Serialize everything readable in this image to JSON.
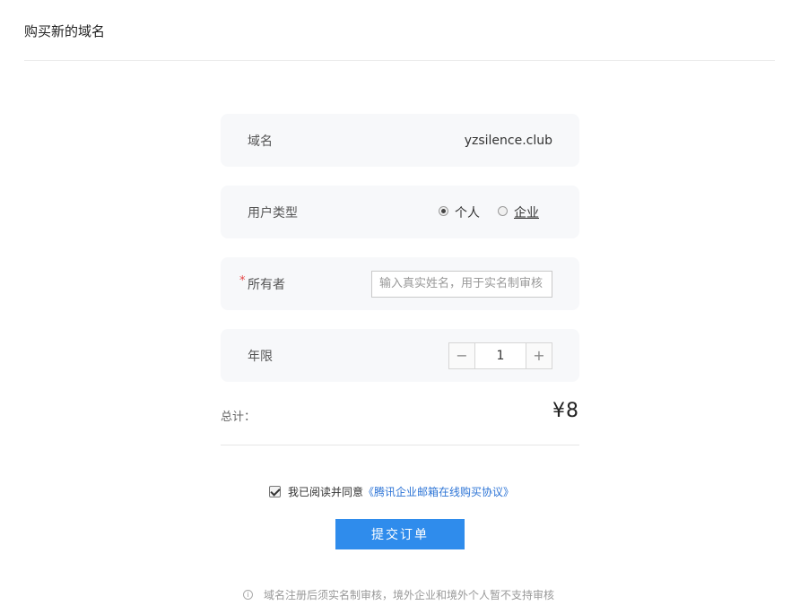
{
  "page": {
    "title": "购买新的域名"
  },
  "form": {
    "domain": {
      "label": "域名",
      "value": "yzsilence.club"
    },
    "user_type": {
      "label": "用户类型",
      "options": [
        {
          "label": "个人",
          "checked": true
        },
        {
          "label": "企业",
          "checked": false
        }
      ]
    },
    "owner": {
      "required_mark": "*",
      "label": "所有者",
      "value": "",
      "placeholder": "输入真实姓名，用于实名制审核"
    },
    "duration": {
      "label": "年限",
      "minus": "−",
      "value": "1",
      "plus": "+"
    }
  },
  "summary": {
    "total_label": "总计：",
    "currency": "¥",
    "total_value": "8"
  },
  "agreement": {
    "checked": true,
    "text": "我已阅读并同意",
    "link_text": "《腾讯企业邮箱在线购买协议》"
  },
  "actions": {
    "submit_label": "提交订单"
  },
  "notice": {
    "icon": "info-icon",
    "text": "域名注册后须实名制审核，境外企业和境外个人暂不支持审核"
  }
}
